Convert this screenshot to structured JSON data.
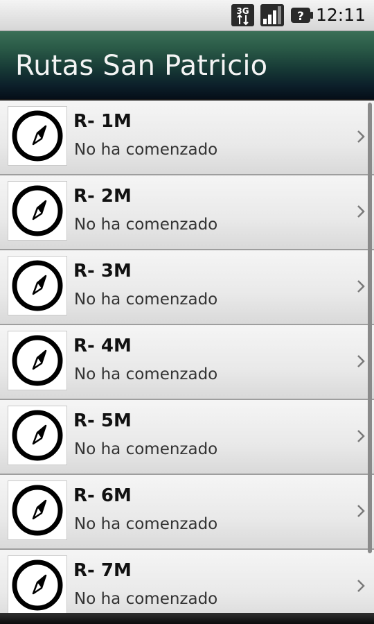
{
  "status_bar": {
    "network_label": "3G",
    "time": "12:11",
    "icons": [
      "3g-data-icon",
      "signal-icon",
      "battery-unknown-icon"
    ]
  },
  "app": {
    "title": "Rutas San Patricio"
  },
  "routes": [
    {
      "name": "R- 1M",
      "status": "No ha comenzado",
      "icon": "compass-icon"
    },
    {
      "name": "R- 2M",
      "status": "No ha comenzado",
      "icon": "compass-icon"
    },
    {
      "name": "R- 3M",
      "status": "No ha comenzado",
      "icon": "compass-icon"
    },
    {
      "name": "R- 4M",
      "status": "No ha comenzado",
      "icon": "compass-icon"
    },
    {
      "name": "R- 5M",
      "status": "No ha comenzado",
      "icon": "compass-icon"
    },
    {
      "name": "R- 6M",
      "status": "No ha comenzado",
      "icon": "compass-icon"
    },
    {
      "name": "R- 7M",
      "status": "No ha comenzado",
      "icon": "compass-icon"
    }
  ],
  "colors": {
    "title_bar_top": "#3a6f56",
    "title_bar_bottom": "#050e18",
    "row_background": "#ececec",
    "title_text": "#f4f4f4"
  }
}
